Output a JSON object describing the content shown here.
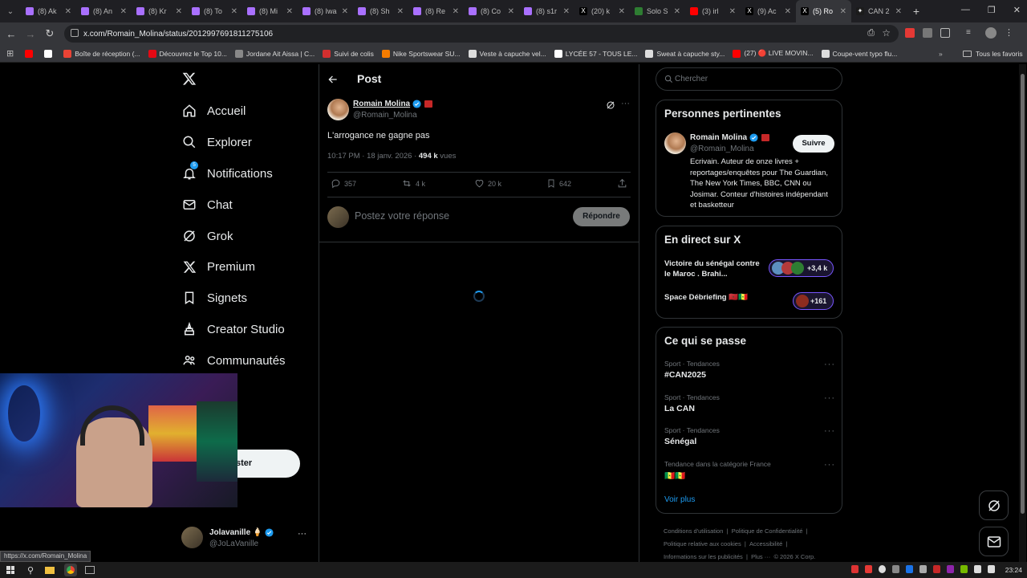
{
  "browser": {
    "tabs": [
      {
        "label": "(8) Ak",
        "color": "#a970ff",
        "glyph": ""
      },
      {
        "label": "(8) An",
        "color": "#a970ff",
        "glyph": ""
      },
      {
        "label": "(8) Kr",
        "color": "#a970ff",
        "glyph": ""
      },
      {
        "label": "(8) To",
        "color": "#a970ff",
        "glyph": ""
      },
      {
        "label": "(8) Mi",
        "color": "#a970ff",
        "glyph": ""
      },
      {
        "label": "(8) Iwa",
        "color": "#a970ff",
        "glyph": ""
      },
      {
        "label": "(8) Sh",
        "color": "#a970ff",
        "glyph": ""
      },
      {
        "label": "(8) Re",
        "color": "#a970ff",
        "glyph": ""
      },
      {
        "label": "(8) Co",
        "color": "#a970ff",
        "glyph": ""
      },
      {
        "label": "(8) s1r",
        "color": "#a970ff",
        "glyph": ""
      },
      {
        "label": "(20) k",
        "color": "#000000",
        "glyph": "X"
      },
      {
        "label": "Solo S",
        "color": "#2e7d32",
        "glyph": ""
      },
      {
        "label": "(3) irl",
        "color": "#ff0000",
        "glyph": ""
      },
      {
        "label": "(9) Ac",
        "color": "#000000",
        "glyph": "X"
      },
      {
        "label": "(5) Ro",
        "color": "#000000",
        "glyph": "X"
      },
      {
        "label": "CAN 2",
        "color": "#1b1b1b",
        "glyph": "✦"
      }
    ],
    "active_tab": 14,
    "url": "x.com/Romain_Molina/status/2012997691811275106",
    "bookmarks": [
      {
        "label": "",
        "color": "#ff0000"
      },
      {
        "label": "",
        "color": "#ffffff"
      },
      {
        "label": "Boîte de réception (...",
        "color": "#ea4335"
      },
      {
        "label": "Découvrez le Top 10...",
        "color": "#e50914"
      },
      {
        "label": "Jordane Ait Aissa | C...",
        "color": "#888888"
      },
      {
        "label": "Suivi de colis",
        "color": "#d32f2f"
      },
      {
        "label": "Nike Sportswear SU...",
        "color": "#f57c00"
      },
      {
        "label": "Veste à capuche vel...",
        "color": "#dddddd"
      },
      {
        "label": "LYCÉE 57 - TOUS LE...",
        "color": "#ffffff"
      },
      {
        "label": "Sweat à capuche sty...",
        "color": "#dddddd"
      },
      {
        "label": "(27) 🔴 LIVE MOVIN...",
        "color": "#ff0000"
      },
      {
        "label": "Coupe-vent typo flu...",
        "color": "#dddddd"
      }
    ],
    "all_bookmarks": "Tous les favoris",
    "status_url": "https://x.com/Romain_Molina"
  },
  "nav": {
    "items": [
      {
        "label": "Accueil",
        "icon": "home-icon"
      },
      {
        "label": "Explorer",
        "icon": "search-icon"
      },
      {
        "label": "Notifications",
        "icon": "bell-icon"
      },
      {
        "label": "Chat",
        "icon": "mail-icon"
      },
      {
        "label": "Grok",
        "icon": "grok-icon"
      },
      {
        "label": "Premium",
        "icon": "x-icon"
      },
      {
        "label": "Signets",
        "icon": "bookmark-icon"
      },
      {
        "label": "Creator Studio",
        "icon": "creator-icon"
      },
      {
        "label": "Communautés",
        "icon": "communities-icon"
      }
    ],
    "notif_badge": "5",
    "post_button_partial": "ster",
    "user": {
      "name": "Jolavanille 🍦",
      "handle": "@JoLaVanille"
    }
  },
  "post": {
    "header": "Post",
    "author_name": "Romain Molina",
    "author_handle": "@Romain_Molina",
    "text": "L'arrogance ne gagne pas",
    "time": "10:17 PM · 18 janv. 2026 · ",
    "views_count": "494 k",
    "views_label": " vues",
    "replies": "357",
    "reposts": "4 k",
    "likes": "20 k",
    "bookmarks": "642",
    "reply_placeholder": "Postez votre réponse",
    "reply_button": "Répondre"
  },
  "sidebar": {
    "search_placeholder": "Chercher",
    "relevant": {
      "title": "Personnes pertinentes",
      "name": "Romain Molina",
      "handle": "@Romain_Molina",
      "follow": "Suivre",
      "bio": "Ecrivain. Auteur de onze livres + reportages/enquêtes pour The Guardian, The New York Times, BBC, CNN ou Josimar. Conteur d'histoires indépendant et basketteur"
    },
    "live": {
      "title": "En direct sur X",
      "items": [
        {
          "text": "Victoire du sénégal contre le Maroc . Brahi...",
          "count": "+3,4 k"
        },
        {
          "text": "Space Débriefing 🇲🇦🇸🇳",
          "count": "+161"
        }
      ]
    },
    "trends": {
      "title": "Ce qui se passe",
      "items": [
        {
          "meta": "Sport · Tendances",
          "name": "#CAN2025"
        },
        {
          "meta": "Sport · Tendances",
          "name": "La CAN"
        },
        {
          "meta": "Sport · Tendances",
          "name": "Sénégal"
        },
        {
          "meta": "Tendance dans la catégorie France",
          "name": "🇸🇳🇸🇳"
        }
      ],
      "more": "Voir plus"
    },
    "footer": {
      "links": [
        "Conditions d'utilisation",
        "Politique de Confidentialité",
        "Politique relative aux cookies",
        "Accessibilité",
        "Informations sur les publicités",
        "Plus ···",
        "© 2026 X Corp."
      ]
    }
  },
  "taskbar": {
    "time": "23:24"
  }
}
